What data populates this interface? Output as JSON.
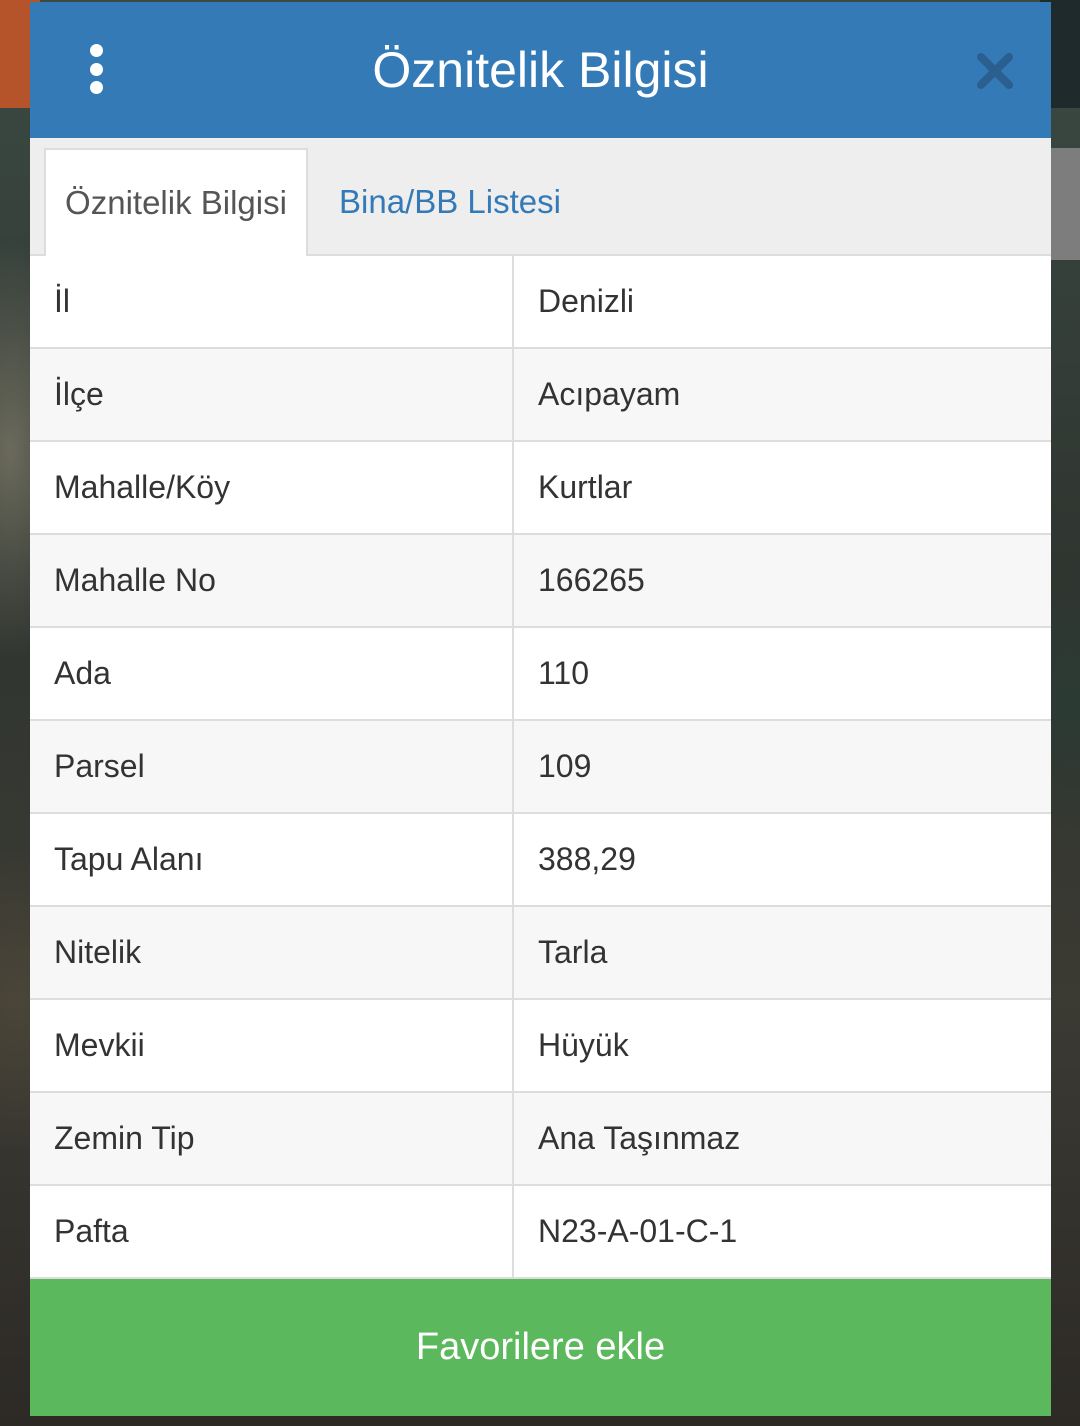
{
  "dialog": {
    "title": "Öznitelik Bilgisi",
    "header_color": "#337ab7"
  },
  "tabs": [
    {
      "label": "Öznitelik Bilgisi",
      "active": true
    },
    {
      "label": "Bina/BB Listesi",
      "active": false
    }
  ],
  "attributes": [
    {
      "label": "İl",
      "value": "Denizli"
    },
    {
      "label": "İlçe",
      "value": "Acıpayam"
    },
    {
      "label": "Mahalle/Köy",
      "value": "Kurtlar"
    },
    {
      "label": "Mahalle No",
      "value": "166265"
    },
    {
      "label": "Ada",
      "value": "110"
    },
    {
      "label": "Parsel",
      "value": "109"
    },
    {
      "label": "Tapu Alanı",
      "value": "388,29"
    },
    {
      "label": "Nitelik",
      "value": "Tarla"
    },
    {
      "label": "Mevkii",
      "value": "Hüyük"
    },
    {
      "label": "Zemin Tip",
      "value": "Ana Taşınmaz"
    },
    {
      "label": "Pafta",
      "value": "N23-A-01-C-1"
    }
  ],
  "footer": {
    "button_label": "Favorilere ekle",
    "button_color": "#5cb85c"
  },
  "icons": {
    "menu": "more-vertical-icon",
    "close": "close-icon"
  }
}
